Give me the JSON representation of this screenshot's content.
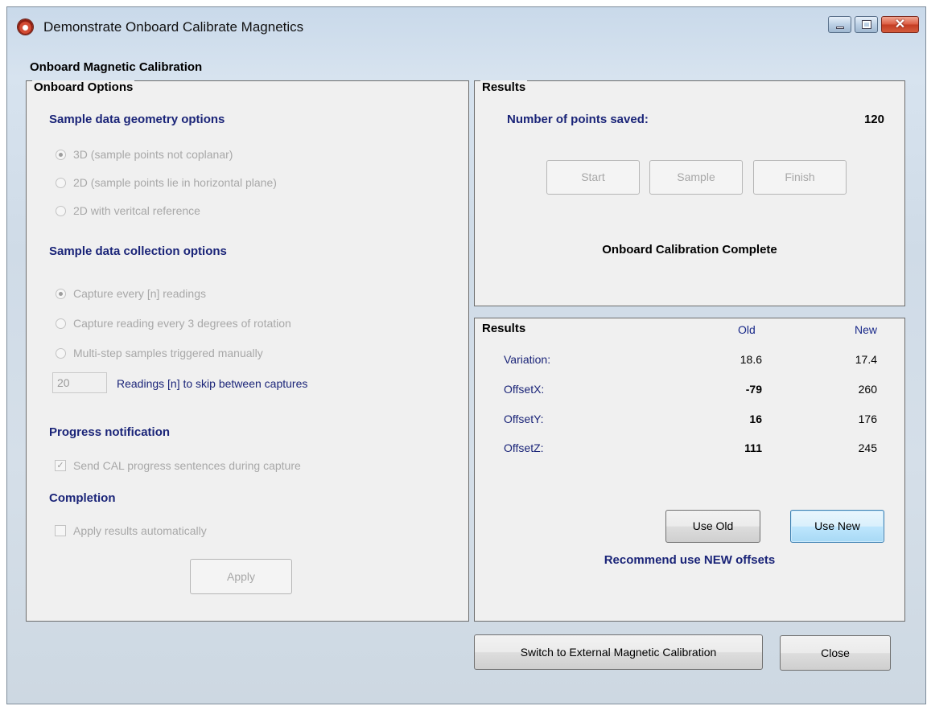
{
  "window": {
    "title": "Demonstrate Onboard Calibrate Magnetics",
    "minimize_glyph": "minimize-icon",
    "maximize_glyph": "maximize-icon",
    "close_glyph": "✕"
  },
  "form_title": "Onboard Magnetic Calibration",
  "onboard_options": {
    "legend": "Onboard Options",
    "geometry_heading": "Sample data geometry options",
    "geometry_options": [
      {
        "label": "3D  (sample points not coplanar)",
        "checked": true
      },
      {
        "label": "2D  (sample points lie in horizontal plane)",
        "checked": false
      },
      {
        "label": "2D with veritcal reference",
        "checked": false
      }
    ],
    "collection_heading": "Sample data collection options",
    "collection_options": [
      {
        "label": "Capture every [n] readings",
        "checked": true
      },
      {
        "label": "Capture reading every 3 degrees of rotation",
        "checked": false
      },
      {
        "label": "Multi-step samples triggered manually",
        "checked": false
      }
    ],
    "skip_value": "20",
    "skip_label": "Readings [n] to skip between captures",
    "progress_heading": "Progress notification",
    "progress_checkbox": "Send CAL progress sentences during capture",
    "progress_check_glyph": "✓",
    "completion_heading": "Completion",
    "completion_checkbox": "Apply results automatically",
    "apply_button": "Apply"
  },
  "results_top": {
    "legend": "Results",
    "points_label": "Number of points saved:",
    "points_value": "120",
    "start_button": "Start",
    "sample_button": "Sample",
    "finish_button": "Finish",
    "status": "Onboard Calibration Complete"
  },
  "results_bottom": {
    "legend": "Results",
    "old_header": "Old",
    "new_header": "New",
    "rows": [
      {
        "label": "Variation:",
        "old": "18.6",
        "new": "17.4"
      },
      {
        "label": "OffsetX:",
        "old": "-79",
        "new": "260"
      },
      {
        "label": "OffsetY:",
        "old": "16",
        "new": "176"
      },
      {
        "label": "OffsetZ:",
        "old": "111",
        "new": "245"
      }
    ],
    "use_old_button": "Use Old",
    "use_new_button": "Use New",
    "recommendation": "Recommend use NEW offsets"
  },
  "footer": {
    "switch_button": "Switch to External Magnetic Calibration",
    "close_button": "Close"
  }
}
